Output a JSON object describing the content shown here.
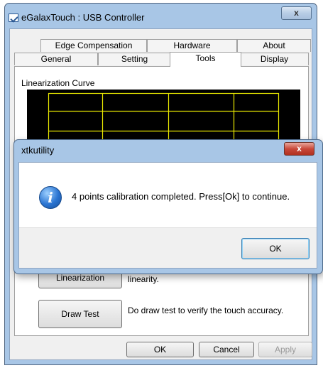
{
  "main_window": {
    "title": "eGalaxTouch : USB Controller",
    "close_label": "x"
  },
  "tabs": {
    "row_back": [
      "Edge Compensation",
      "Hardware",
      "About"
    ],
    "row_front": [
      "General",
      "Setting",
      "Tools",
      "Display"
    ],
    "active": "Tools"
  },
  "tools": {
    "linearization_curve_label": "Linearization Curve",
    "linearization_button": "Linearization",
    "linearization_desc": "linearity.",
    "draw_test_button": "Draw Test",
    "draw_test_desc": "Do draw test to verify the touch accuracy."
  },
  "footer": {
    "ok": "OK",
    "cancel": "Cancel",
    "apply": "Apply"
  },
  "dialog": {
    "title": "xtkutility",
    "close_label": "x",
    "message": "4 points calibration completed. Press[Ok] to continue.",
    "ok": "OK",
    "icon": "info-icon"
  },
  "colors": {
    "graph_background": "#000000",
    "graph_grid": "#e8e800",
    "frame_accent": "#a8c6e6"
  }
}
